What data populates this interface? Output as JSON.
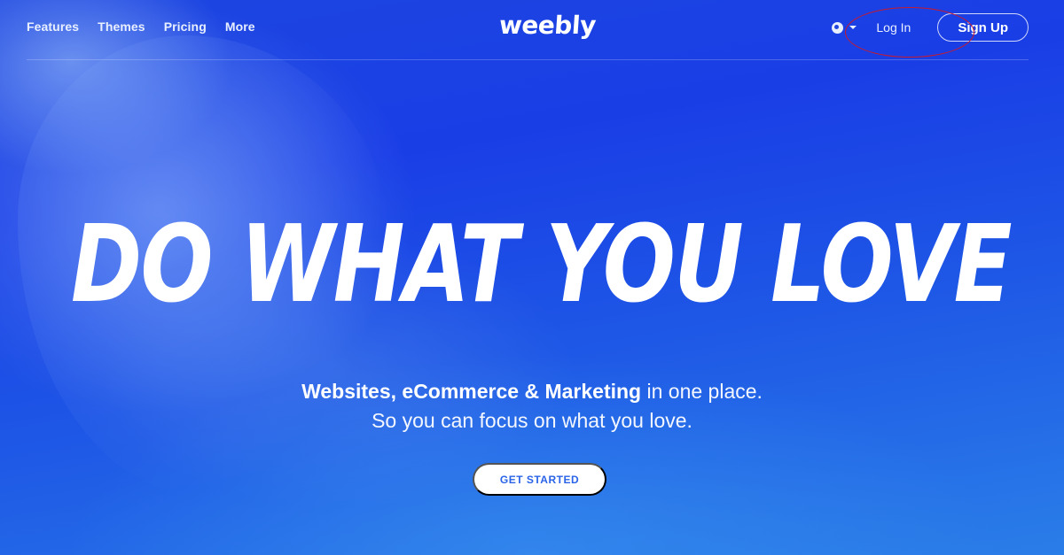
{
  "nav": {
    "items": [
      {
        "label": "Features"
      },
      {
        "label": "Themes"
      },
      {
        "label": "Pricing"
      },
      {
        "label": "More"
      }
    ],
    "logo_text": "weebly",
    "login_label": "Log In",
    "signup_label": "Sign Up"
  },
  "hero": {
    "headline": "DO WHAT YOU LOVE",
    "tagline_bold": "Websites, eCommerce & Marketing",
    "tagline_rest": " in one place.",
    "tagline_line2": "So you can focus on what you love.",
    "cta_label": "GET STARTED"
  },
  "icons": {
    "globe": "globe-icon",
    "caret": "caret-down-icon"
  },
  "colors": {
    "background_primary": "#1d46e0",
    "background_secondary": "#2a7ee8",
    "cta_text": "#2a63e8",
    "annotation": "#c81a2e"
  }
}
